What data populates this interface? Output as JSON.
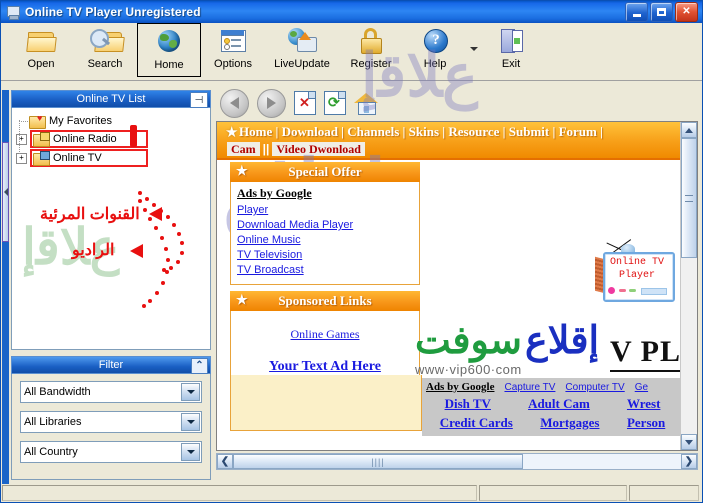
{
  "window": {
    "title": "Online TV Player Unregistered",
    "icon": "tv-app-icon",
    "buttons": {
      "minimize": "minimize-icon",
      "maximize": "maximize-icon",
      "close": "close-icon"
    }
  },
  "toolbar": {
    "items": [
      {
        "label": "Open",
        "icon": "open-folder-icon",
        "selected": false
      },
      {
        "label": "Search",
        "icon": "search-folder-icon",
        "selected": false
      },
      {
        "label": "Home",
        "icon": "globe-icon",
        "selected": true
      },
      {
        "label": "Options",
        "icon": "options-window-icon",
        "selected": false
      },
      {
        "label": "LiveUpdate",
        "icon": "live-update-icon",
        "selected": false
      },
      {
        "label": "Register",
        "icon": "lock-icon",
        "selected": false
      },
      {
        "label": "Help",
        "icon": "help-icon",
        "selected": false
      },
      {
        "label": "Exit",
        "icon": "exit-door-icon",
        "selected": false
      }
    ],
    "overflow_icon": "chevron-down-icon",
    "help_glyph": "?"
  },
  "left_panel": {
    "title": "Online TV List",
    "pin_icon": "pin-icon",
    "tree": [
      {
        "label": "My Favorites",
        "icon": "favorites-folder-icon",
        "expander": "",
        "highlighted": false
      },
      {
        "label": "Online Radio",
        "icon": "radio-folder-icon",
        "expander": "+",
        "highlighted": true
      },
      {
        "label": "Online TV",
        "icon": "tv-folder-icon",
        "expander": "+",
        "highlighted": true
      }
    ],
    "filter": {
      "title": "Filter",
      "collapse_icon": "chevron-up-icon",
      "selects": [
        {
          "name": "bandwidth-select",
          "value": "All Bandwidth"
        },
        {
          "name": "libraries-select",
          "value": "All Libraries"
        },
        {
          "name": "country-select",
          "value": "All Country"
        }
      ]
    }
  },
  "annotations": {
    "channels": "القنوات المرئية",
    "radio": "الراديو"
  },
  "watermarks": {
    "brand_green": "سوفت",
    "brand_blue": "إقلاع",
    "site": "www·vip600·com",
    "purple_overlay": "اقلاع"
  },
  "browser": {
    "nav": [
      {
        "name": "back-button",
        "icon": "arrow-left-icon"
      },
      {
        "name": "forward-button",
        "icon": "arrow-right-icon"
      },
      {
        "name": "stop-button",
        "icon": "stop-page-icon"
      },
      {
        "name": "refresh-button",
        "icon": "refresh-icon"
      },
      {
        "name": "home-button",
        "icon": "house-icon"
      }
    ],
    "scrollbars": {
      "vertical": {
        "up": "scroll-up-icon",
        "down": "scroll-down-icon"
      },
      "horizontal": {
        "left": "❮",
        "right": "❯",
        "grip": "||||"
      }
    }
  },
  "webpage": {
    "nav_primary": "Home | Download | Channels | Skins | Resource | Submit | Forum |",
    "nav_secondary": {
      "cam": "Cam",
      "sep": "||",
      "video": "Video Dwonload"
    },
    "special_offer": {
      "title": "Special Offer",
      "ads_heading": "Ads by Google",
      "links": [
        "Player",
        "Download Media Player",
        "Online Music",
        "TV Television",
        "TV Broadcast"
      ]
    },
    "sponsored": {
      "title": "Sponsored Links",
      "link1": "Online Games",
      "link2": "Your Text Ad Here"
    },
    "tv_graphic": {
      "line1": "Online TV",
      "line2": "Player"
    },
    "headline": "V PL",
    "gray_ads": {
      "heading": "Ads by Google",
      "small_links": [
        "Capture TV",
        "Computer TV",
        "Ge"
      ],
      "row_big_1": [
        "Dish TV",
        "Adult Cam",
        "Wrest"
      ],
      "row_big_2": [
        "Credit Cards",
        "Mortgages",
        "Person"
      ]
    }
  },
  "statusbar": {
    "cell1": "",
    "cell2": "",
    "cell3": ""
  },
  "colors": {
    "title_blue": "#1768e8",
    "accent_orange": "#f79f18",
    "link_blue": "#1a1ae0",
    "annotation_red": "#e81010",
    "brand_green": "#1f9c3f",
    "brand_blue": "#1a2fc0"
  }
}
